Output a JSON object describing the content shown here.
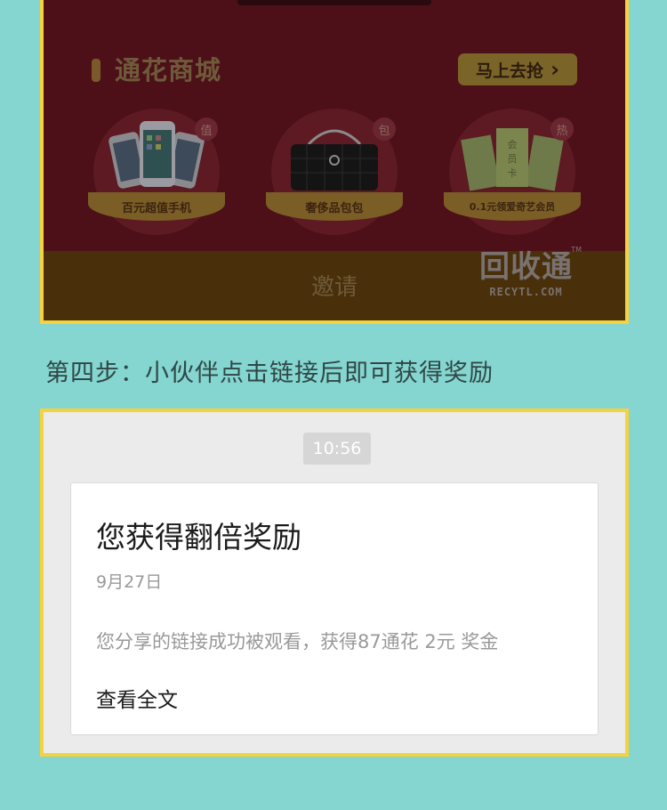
{
  "mall": {
    "title": "通花商城",
    "grab_button": "马上去抢",
    "products": [
      {
        "tag": "值",
        "label": "百元超值手机",
        "icon": "phones-image"
      },
      {
        "tag": "包",
        "label": "奢侈品包包",
        "icon": "handbag-image"
      },
      {
        "tag": "热",
        "label": "0.1元领爱奇艺会员",
        "icon": "member-card-image",
        "card_text": "会员卡"
      }
    ],
    "invite_label": "邀请",
    "logo": {
      "name": "回收通",
      "domain": "RECYTL.COM",
      "tm": "TM"
    }
  },
  "step_text": "第四步：小伙伴点击链接后即可获得奖励",
  "chat": {
    "time": "10:56",
    "card": {
      "title": "您获得翻倍奖励",
      "date": "9月27日",
      "body": "您分享的链接成功被观看，获得87通花 2元 奖金",
      "link": "查看全文"
    }
  },
  "colors": {
    "background": "#85d5d0",
    "frame_border": "#f7d23f",
    "mall_bg": "#4d1018"
  }
}
